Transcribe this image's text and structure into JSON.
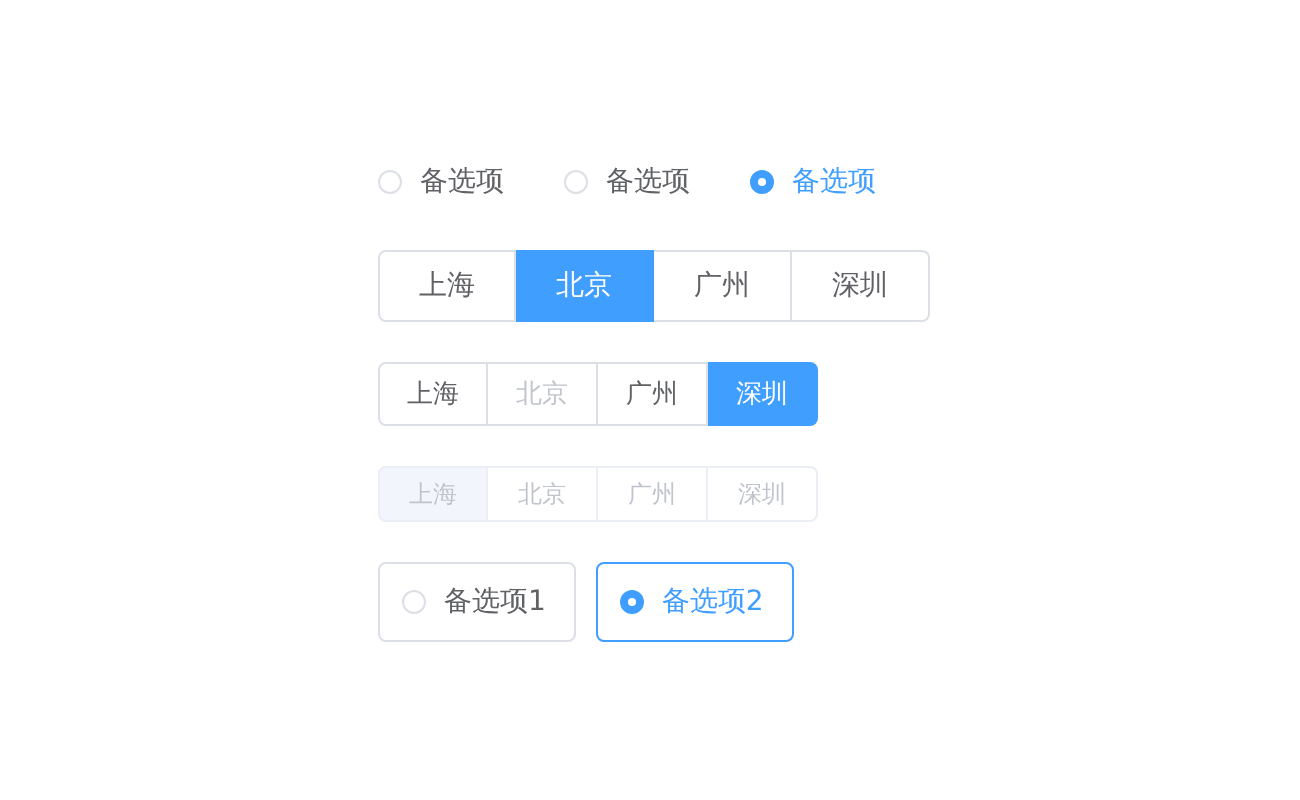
{
  "groups": [
    {
      "kind": "radio",
      "items": [
        {
          "label": "备选项",
          "selected": false,
          "disabled": false
        },
        {
          "label": "备选项",
          "selected": false,
          "disabled": false
        },
        {
          "label": "备选项",
          "selected": true,
          "disabled": false
        }
      ]
    },
    {
      "kind": "large_buttons",
      "items": [
        {
          "label": "上海",
          "selected": false,
          "disabled": false
        },
        {
          "label": "北京",
          "selected": true,
          "disabled": false
        },
        {
          "label": "广州",
          "selected": false,
          "disabled": false
        },
        {
          "label": "深圳",
          "selected": false,
          "disabled": false
        }
      ]
    },
    {
      "kind": "medium_buttons",
      "items": [
        {
          "label": "上海",
          "selected": false,
          "disabled": false
        },
        {
          "label": "北京",
          "selected": false,
          "disabled": true
        },
        {
          "label": "广州",
          "selected": false,
          "disabled": false
        },
        {
          "label": "深圳",
          "selected": true,
          "disabled": false
        }
      ]
    },
    {
      "kind": "small_buttons",
      "items": [
        {
          "label": "上海",
          "selected": true,
          "disabled": true
        },
        {
          "label": "北京",
          "selected": false,
          "disabled": true
        },
        {
          "label": "广州",
          "selected": false,
          "disabled": true
        },
        {
          "label": "深圳",
          "selected": false,
          "disabled": true
        }
      ]
    },
    {
      "kind": "bordered",
      "items": [
        {
          "label": "备选项1",
          "selected": false,
          "disabled": false
        },
        {
          "label": "备选项2",
          "selected": true,
          "disabled": false
        }
      ]
    }
  ]
}
